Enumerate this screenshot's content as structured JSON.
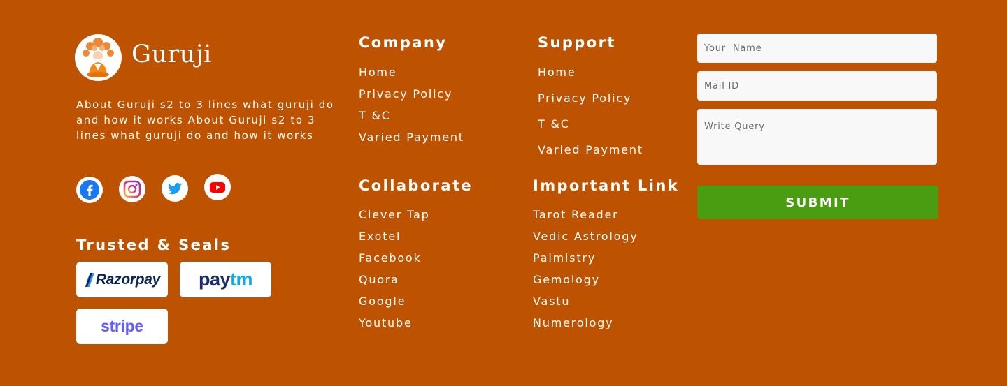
{
  "brand": {
    "name": "Guruji",
    "about": "About Guruji s2 to 3 lines what guruji do and how it works About Guruji s2 to 3 lines what guruji do and how it works"
  },
  "social": [
    {
      "name": "facebook-icon",
      "color": "#1877f2"
    },
    {
      "name": "instagram-icon",
      "color": "#e1306c"
    },
    {
      "name": "twitter-icon",
      "color": "#1d9bf0"
    },
    {
      "name": "youtube-icon",
      "color": "#ff0000"
    }
  ],
  "trusted": {
    "title": "Trusted & Seals",
    "seals": {
      "razorpay": "Razorpay",
      "paytm_pay": "pay",
      "paytm_tm": "tm",
      "stripe": "stripe"
    }
  },
  "company": {
    "title": "Company",
    "links": [
      "Home",
      "Privacy Policy",
      "T &C",
      "Varied Payment"
    ]
  },
  "support": {
    "title": "Support",
    "links": [
      "Home",
      "Privacy Policy",
      "T &C",
      "Varied Payment"
    ]
  },
  "collaborate": {
    "title": "Collaborate",
    "links": [
      "Clever Tap",
      "Exotel",
      "Facebook",
      "Quora",
      "Google",
      "Youtube"
    ]
  },
  "important": {
    "title": "Important Link",
    "links": [
      "Tarot Reader",
      "Vedic Astrology",
      "Palmistry",
      "Gemology",
      "Vastu",
      "Numerology"
    ]
  },
  "form": {
    "name_placeholder": "Your  Name",
    "mail_placeholder": "Mail ID",
    "query_placeholder": "Write Query",
    "submit_label": "SUBMIT"
  },
  "colors": {
    "background": "#bd5300",
    "submit": "#4a9c10"
  }
}
